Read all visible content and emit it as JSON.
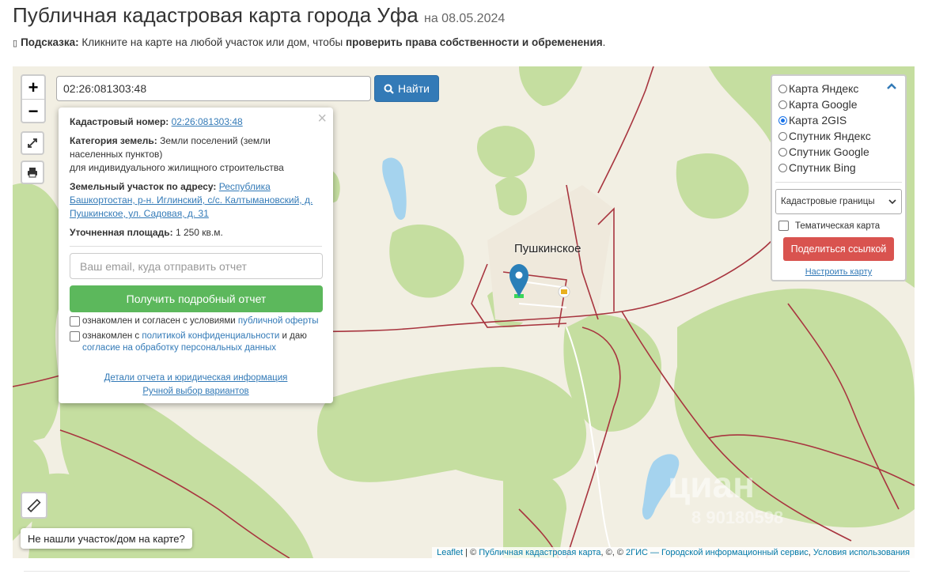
{
  "header": {
    "title": "Публичная кадастровая карта города Уфа",
    "date": "на 08.05.2024"
  },
  "hint": {
    "icon": "info-icon",
    "label": "Подсказка:",
    "text": "Кликните на карте на любой участок или дом, чтобы",
    "bold_text": "проверить права собственности и обременения",
    "end": "."
  },
  "map": {
    "zoom_in": "+",
    "zoom_out": "−",
    "search": {
      "value": "02:26:081303:48",
      "button_label": "Найти"
    },
    "place_label": "Пушкинское",
    "watermark": "циан",
    "watermark_number": "8 90180598",
    "not_found_button": "Не нашли участок/дом на карте?",
    "attribution": {
      "leaflet": "Leaflet",
      "sep1": " | © ",
      "cadastral": "Публичная кадастровая карта",
      "sep2": ", ©, © ",
      "provider": "2ГИС — Городской информационный сервис",
      "sep3": ", ",
      "terms": "Условия использования"
    }
  },
  "popup": {
    "cadastral_label": "Кадастровый номер:",
    "cadastral_value": "02:26:081303:48",
    "category_label": "Категория земель:",
    "category_value": "Земли поселений (земли населенных пунктов)",
    "category_use": "для индивидуального жилищного строительства",
    "address_label": "Земельный участок по адресу:",
    "address_value": "Республика Башкортостан, р-н. Иглинский, с/с. Калтымановский, д. Пушкинское, ул. Садовая, д. 31",
    "area_label": "Уточненная площадь:",
    "area_value": "1 250 кв.м.",
    "email_placeholder": "Ваш email, куда отправить отчет",
    "report_button": "Получить подробный отчет",
    "agree1_text": "ознакомлен и согласен с условиями",
    "agree1_link": "публичной оферты",
    "agree2_text": "ознакомлен с",
    "agree2_link": "политикой конфиденциальности",
    "agree2_and": "и даю",
    "agree2_link2": "согласие на обработку персональных данных",
    "details_link": "Детали отчета и юридическая информация",
    "manual_link": "Ручной выбор вариантов"
  },
  "layers": {
    "options": [
      {
        "label": "Карта Яндекс",
        "selected": false
      },
      {
        "label": "Карта Google",
        "selected": false
      },
      {
        "label": "Карта 2GIS",
        "selected": true
      },
      {
        "label": "Спутник Яндекс",
        "selected": false
      },
      {
        "label": "Спутник Google",
        "selected": false
      },
      {
        "label": "Спутник Bing",
        "selected": false
      }
    ],
    "overlay_select": "Кадастровые границы",
    "thematic_label": "Тематическая карта",
    "share_button": "Поделиться ссылкой",
    "tune_link": "Настроить карту"
  },
  "colors": {
    "primary": "#337ab7",
    "success": "#5cb85c",
    "danger": "#d9534f",
    "map_bg": "#f2efe3",
    "forest": "#c5dea0",
    "water": "#a5d3ee",
    "road": "#a8353f"
  }
}
